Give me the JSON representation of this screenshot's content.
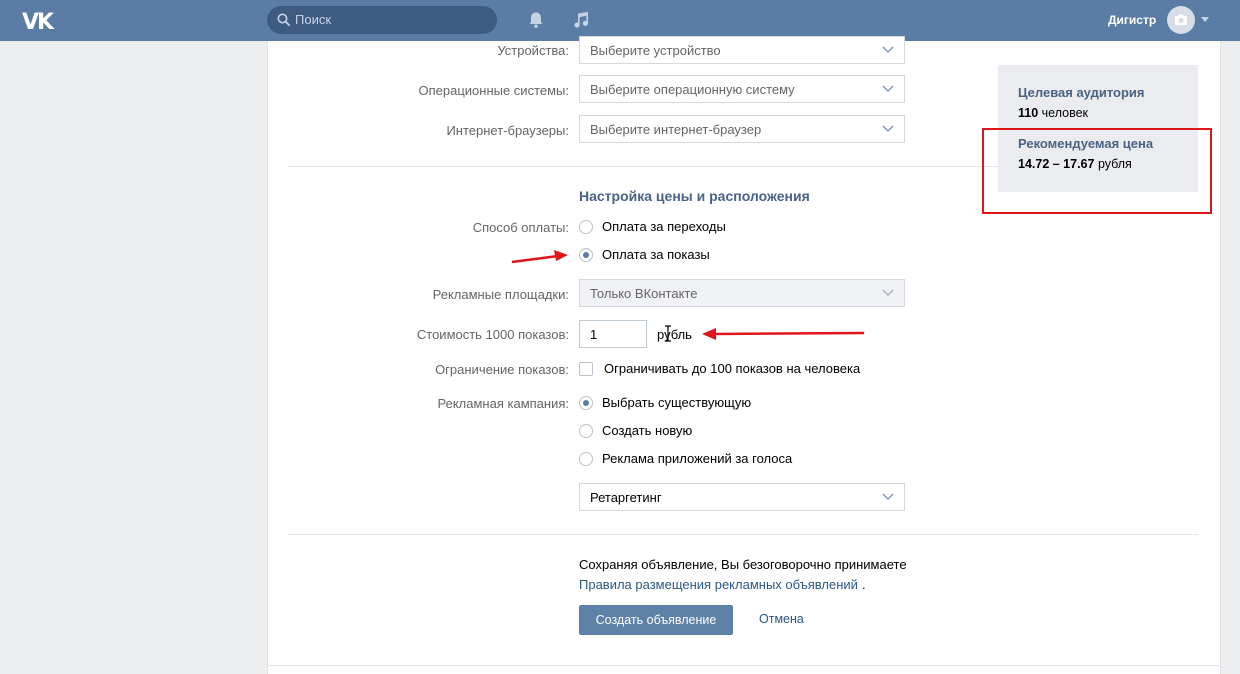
{
  "topbar": {
    "logo": "VK",
    "search_placeholder": "Поиск",
    "username": "Дигистр"
  },
  "targeting": {
    "devices_label": "Устройства:",
    "devices_value": "Выберите устройство",
    "os_label": "Операционные системы:",
    "os_value": "Выберите операционную систему",
    "browsers_label": "Интернет-браузеры:",
    "browsers_value": "Выберите интернет-браузер"
  },
  "pricing": {
    "section_title": "Настройка цены и расположения",
    "payment_label": "Способ оплаты:",
    "payment_options": [
      "Оплата за переходы",
      "Оплата за показы"
    ],
    "payment_selected": "Оплата за показы",
    "platforms_label": "Рекламные площадки:",
    "platforms_value": "Только ВКонтакте",
    "cost_label": "Стоимость 1000 показов:",
    "cost_value": "1",
    "cost_unit": "рубль",
    "limit_label": "Ограничение показов:",
    "limit_text": "Ограничивать до 100 показов на человека",
    "limit_checked": false,
    "campaign_label": "Рекламная кампания:",
    "campaign_options": [
      "Выбрать существующую",
      "Создать новую",
      "Реклама приложений за голоса"
    ],
    "campaign_selected": "Выбрать существующую",
    "campaign_value": "Ретаргетинг"
  },
  "footer": {
    "agree_text": "Сохраняя объявление, Вы безоговорочно принимаете",
    "rules_link": "Правила размещения рекламных объявлений",
    "rules_dot": ".",
    "create_button": "Создать объявление",
    "cancel_button": "Отмена"
  },
  "sidebar": {
    "audience_title": "Целевая аудитория",
    "audience_count": "110",
    "audience_unit": "человек",
    "price_title": "Рекомендуемая цена",
    "price_range": "14.72 – 17.67",
    "price_unit": "рубля"
  },
  "colors": {
    "header": "#5b7da5",
    "accent_text": "#4a6385",
    "link": "#2a5885",
    "annotation_red": "#e0141b"
  }
}
